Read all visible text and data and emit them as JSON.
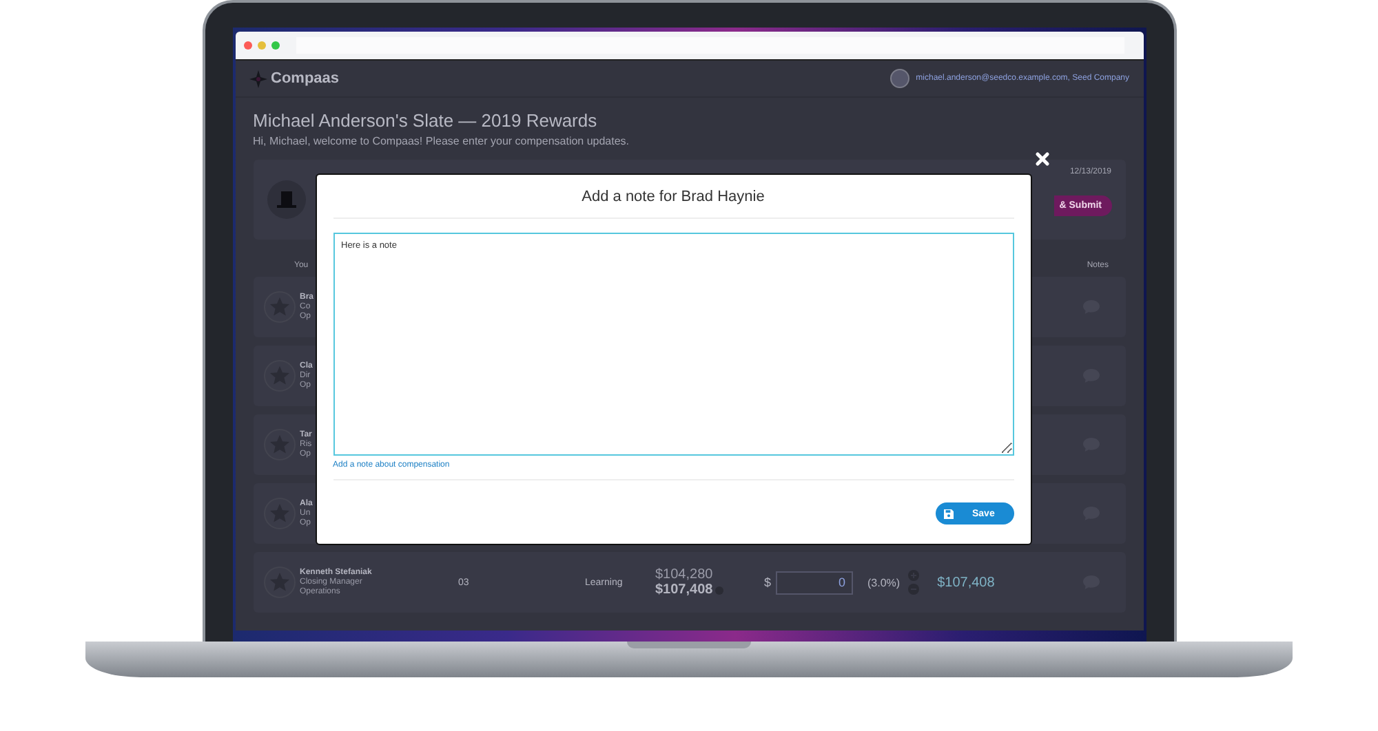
{
  "app": {
    "logo": "Compaas",
    "user": "michael.anderson@seedco.example.com, Seed Company",
    "title": "Michael Anderson's Slate — 2019 Rewards",
    "welcome": "Hi, Michael, welcome to Compaas! Please enter your compensation updates.",
    "date": "12/13/2019",
    "submit_button": "& Submit",
    "columns": [
      "You",
      "Notes"
    ],
    "rows": [
      {
        "kind": "partial",
        "name": "Bra",
        "title": "Co",
        "department": "Op"
      },
      {
        "kind": "partial",
        "name": "Cla",
        "title": "Dir",
        "department": "Op"
      },
      {
        "kind": "partial",
        "name": "Tar",
        "title": "Ris",
        "department": "Op"
      },
      {
        "kind": "partial",
        "name": "Ala",
        "title": "Un",
        "department": "Op"
      },
      {
        "kind": "full",
        "name": "Kenneth Stefaniak",
        "title": "Closing Manager",
        "department": "Operations",
        "grade": "03",
        "performance": "Learning",
        "current_salary": "$104,280",
        "new_salary": "$107,408",
        "currency": "$",
        "increase": "0",
        "percent": "(3.0%)",
        "total": "$107,408"
      }
    ]
  },
  "modal": {
    "title": "Add a note for Brad Haynie",
    "value": "Here is a note",
    "link": "Add a note about compensation",
    "save_button": "Save"
  }
}
